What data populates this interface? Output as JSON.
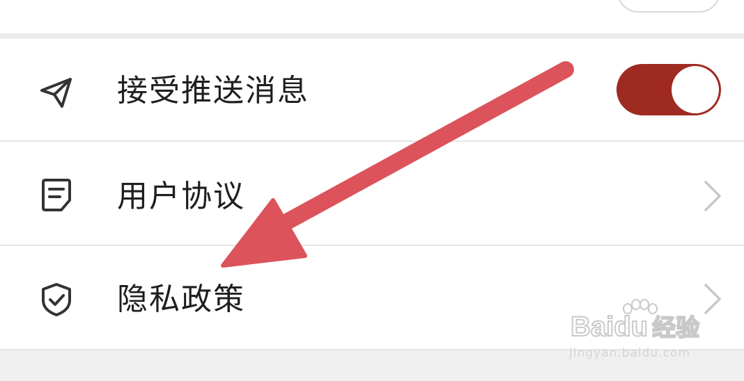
{
  "settings": {
    "items": [
      {
        "label": "接受推送消息",
        "icon": "paper-plane-icon",
        "control": "toggle",
        "toggle_on": true
      },
      {
        "label": "用户协议",
        "icon": "document-icon",
        "control": "chevron"
      },
      {
        "label": "隐私政策",
        "icon": "shield-check-icon",
        "control": "chevron"
      }
    ]
  },
  "colors": {
    "toggle_on": "#9e2a22",
    "annotation_arrow": "#dc535b",
    "divider": "#e6e6e6",
    "label_text": "#1f1f1f",
    "icon_stroke": "#333333",
    "chevron": "#c8c8c8"
  },
  "watermark": {
    "logo_text": "Bai",
    "logo_text_2": "du",
    "logo_suffix": "经验",
    "url": "jingyan.baidu.com"
  }
}
